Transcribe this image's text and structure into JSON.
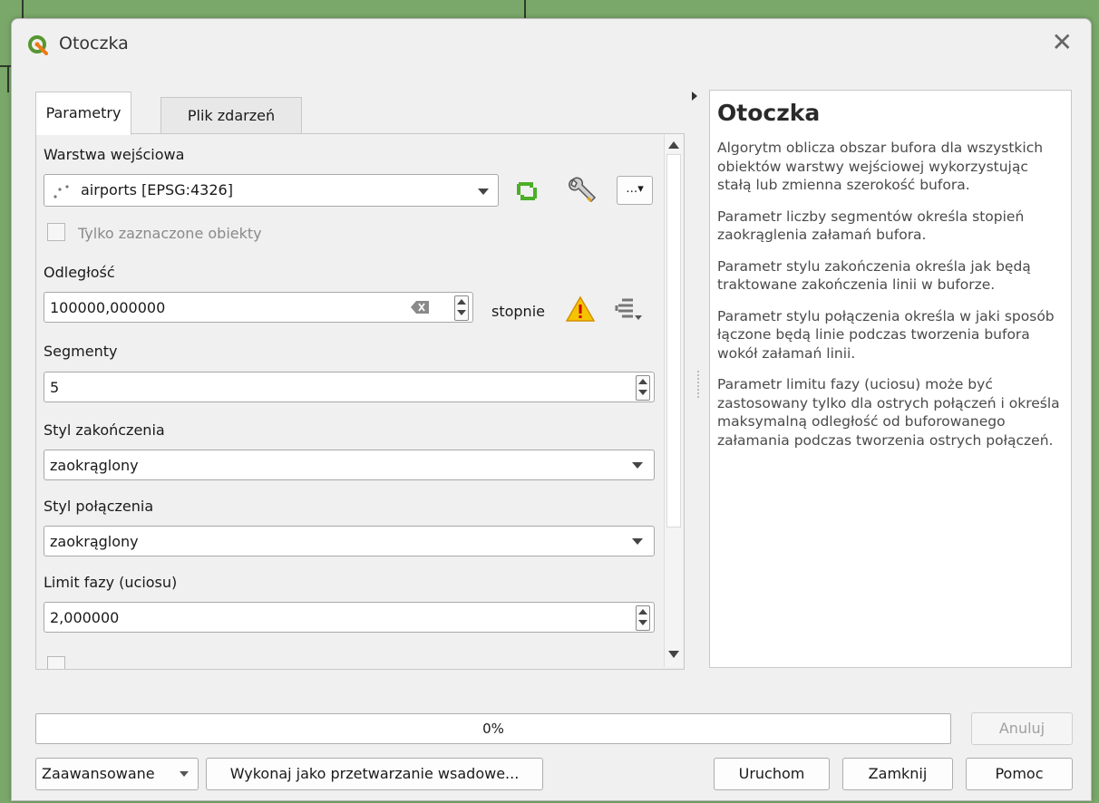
{
  "window": {
    "title": "Otoczka"
  },
  "tabs": [
    {
      "label": "Parametry"
    },
    {
      "label": "Plik zdarzeń"
    }
  ],
  "params": {
    "input_layer_label": "Warstwa wejściowa",
    "input_layer_value": "airports [EPSG:4326]",
    "selected_only_label": "Tylko zaznaczone obiekty",
    "distance_label": "Odległość",
    "distance_value": "100000,000000",
    "distance_unit": "stopnie",
    "segments_label": "Segmenty",
    "segments_value": "5",
    "end_cap_label": "Styl zakończenia",
    "end_cap_value": "zaokrąglony",
    "join_style_label": "Styl połączenia",
    "join_style_value": "zaokrąglony",
    "miter_limit_label": "Limit fazy (uciosu)",
    "miter_limit_value": "2,000000"
  },
  "help": {
    "title": "Otoczka",
    "paragraphs": [
      "Algorytm oblicza obszar bufora dla wszystkich obiektów warstwy wejściowej wykorzystując stałą lub zmienna szerokość bufora.",
      "Parametr liczby segmentów określa stopień zaokrąglenia załamań bufora.",
      "Parametr stylu zakończenia określa jak będą traktowane zakończenia linii w buforze.",
      "Parametr stylu połączenia określa w jaki sposób łączone będą linie podczas tworzenia bufora wokół załamań linii.",
      "Parametr limitu fazy (uciosu) może być zastosowany tylko dla ostrych połączeń i określa maksymalną odległość od buforowanego załamania podczas tworzenia ostrych połączeń."
    ]
  },
  "progress": {
    "text": "0%",
    "value": 0
  },
  "buttons": {
    "cancel": "Anuluj",
    "advanced": "Zaawansowane",
    "batch": "Wykonaj jako przetwarzanie wsadowe...",
    "run": "Uruchom",
    "close": "Zamknij",
    "help": "Pomoc"
  },
  "colors": {
    "accent": "#3a8ddc",
    "warning": "#f5c400",
    "qgis_green": "#589632"
  }
}
